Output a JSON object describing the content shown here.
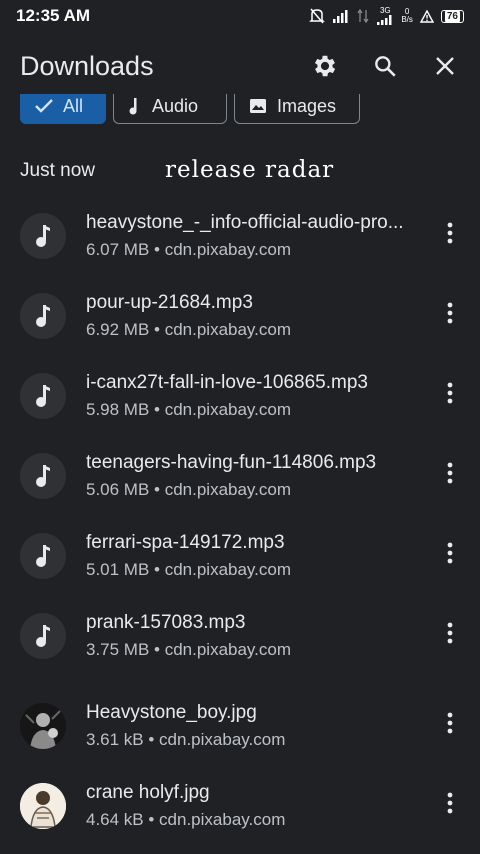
{
  "status_bar": {
    "time": "12:35 AM",
    "net_label": "3G",
    "speed_value": "0",
    "speed_unit": "B/s",
    "battery": "76"
  },
  "header": {
    "title": "Downloads",
    "actions": [
      "gear-icon",
      "search-icon",
      "close-icon"
    ]
  },
  "chips": [
    {
      "label": "All",
      "icon": "check-icon",
      "selected": true
    },
    {
      "label": "Audio",
      "icon": "music-note-icon",
      "selected": false
    },
    {
      "label": "Images",
      "icon": "image-icon",
      "selected": false
    }
  ],
  "section": {
    "title": "Just now"
  },
  "overlay_text": "release radar",
  "files": [
    {
      "name": "heavystone_-_info-official-audio-pro...",
      "meta": "6.07 MB • cdn.pixabay.com",
      "kind": "audio"
    },
    {
      "name": "pour-up-21684.mp3",
      "meta": "6.92 MB • cdn.pixabay.com",
      "kind": "audio"
    },
    {
      "name": "i-canx27t-fall-in-love-106865.mp3",
      "meta": "5.98 MB • cdn.pixabay.com",
      "kind": "audio"
    },
    {
      "name": "teenagers-having-fun-114806.mp3",
      "meta": "5.06 MB • cdn.pixabay.com",
      "kind": "audio"
    },
    {
      "name": "ferrari-spa-149172.mp3",
      "meta": "5.01 MB • cdn.pixabay.com",
      "kind": "audio"
    },
    {
      "name": "prank-157083.mp3",
      "meta": "3.75 MB • cdn.pixabay.com",
      "kind": "audio"
    },
    {
      "name": "Heavystone_boy.jpg",
      "meta": "3.61 kB • cdn.pixabay.com",
      "kind": "image"
    },
    {
      "name": "crane holyf.jpg",
      "meta": "4.64 kB • cdn.pixabay.com",
      "kind": "image"
    }
  ],
  "colors": {
    "background": "#202124",
    "chip_selected": "#1a5fa6",
    "text_primary": "#e8eaed",
    "text_secondary": "#bdc1c6"
  }
}
